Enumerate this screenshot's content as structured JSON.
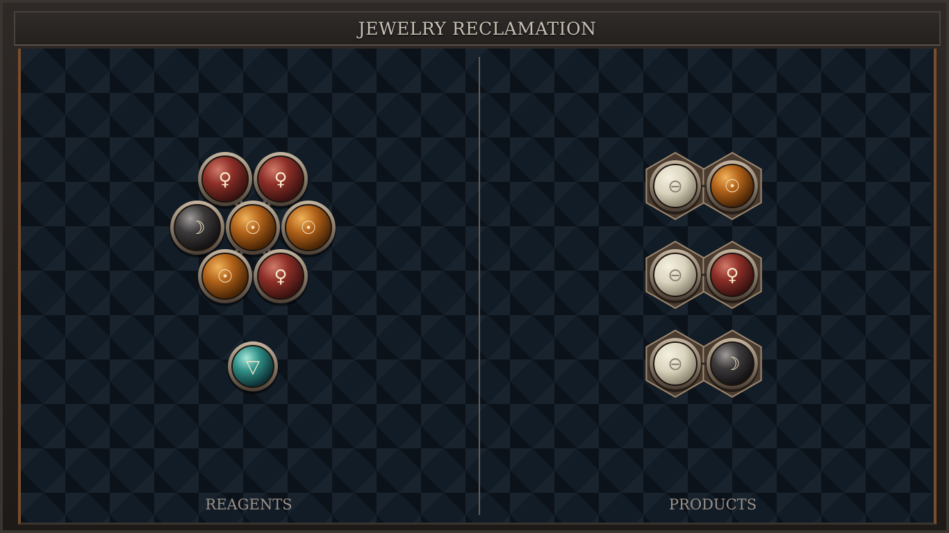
{
  "title": "JEWELRY RECLAMATION",
  "panels": {
    "left_label": "REAGENTS",
    "right_label": "PRODUCTS"
  },
  "reagents": {
    "molecule": [
      {
        "element": "venus-copper",
        "symbol": "♀",
        "color": "#8e2f28"
      },
      {
        "element": "venus-copper",
        "symbol": "♀",
        "color": "#8e2f28"
      },
      {
        "element": "moon-silver",
        "symbol": "☽",
        "color": "#3d3a3b"
      },
      {
        "element": "sun-gold",
        "symbol": "☉",
        "color": "#b3631a"
      },
      {
        "element": "sun-gold",
        "symbol": "☉",
        "color": "#b3631a"
      },
      {
        "element": "sun-gold",
        "symbol": "☉",
        "color": "#b3631a"
      },
      {
        "element": "venus-copper",
        "symbol": "♀",
        "color": "#8e2f28"
      }
    ],
    "single": {
      "element": "water",
      "symbol": "▽",
      "color": "#2f8f86"
    }
  },
  "products": [
    {
      "atoms": [
        {
          "element": "salt",
          "symbol": "⊖",
          "color": "#d9d3bd"
        },
        {
          "element": "sun-gold",
          "symbol": "☉",
          "color": "#b3631a"
        }
      ]
    },
    {
      "atoms": [
        {
          "element": "salt",
          "symbol": "⊖",
          "color": "#d9d3bd"
        },
        {
          "element": "venus-copper",
          "symbol": "♀",
          "color": "#8e2f28"
        }
      ]
    },
    {
      "atoms": [
        {
          "element": "salt",
          "symbol": "⊖",
          "color": "#d9d3bd"
        },
        {
          "element": "moon-silver",
          "symbol": "☽",
          "color": "#3d3a3b"
        }
      ]
    }
  ]
}
